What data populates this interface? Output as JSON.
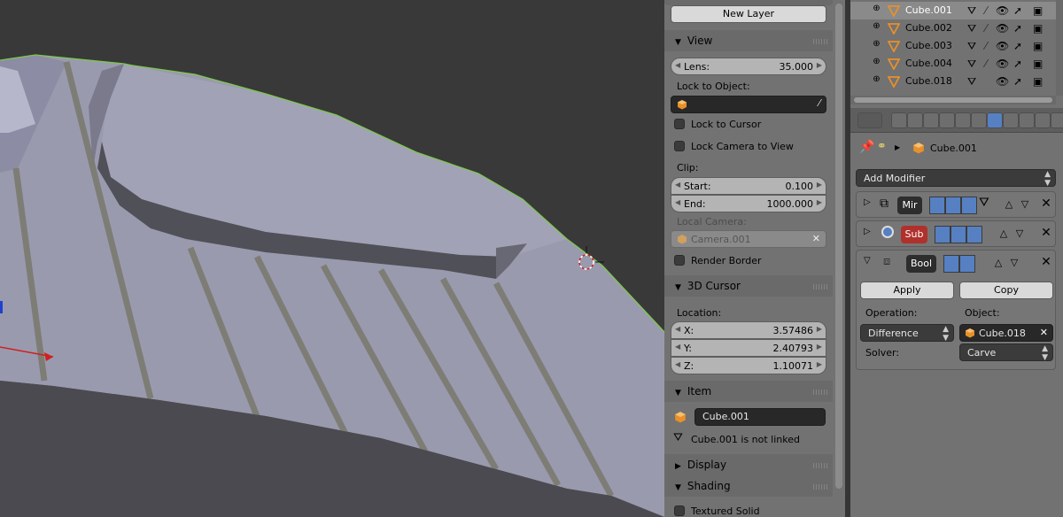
{
  "npanel": {
    "new_layer": "New Layer",
    "view": {
      "title": "View",
      "lens_label": "Lens:",
      "lens_value": "35.000",
      "lock_to_object_label": "Lock to Object:",
      "lock_to_cursor": "Lock to Cursor",
      "lock_camera_to_view": "Lock Camera to View",
      "clip_label": "Clip:",
      "clip_start_label": "Start:",
      "clip_start_value": "0.100",
      "clip_end_label": "End:",
      "clip_end_value": "1000.000",
      "local_camera_label": "Local Camera:",
      "local_camera_value": "Camera.001",
      "render_border": "Render Border"
    },
    "cursor": {
      "title": "3D Cursor",
      "location_label": "Location:",
      "x_label": "X:",
      "x_value": "3.57486",
      "y_label": "Y:",
      "y_value": "2.40793",
      "z_label": "Z:",
      "z_value": "1.10071"
    },
    "item": {
      "title": "Item",
      "name": "Cube.001",
      "linked_status": "Cube.001 is not linked"
    },
    "display": {
      "title": "Display"
    },
    "shading": {
      "title": "Shading",
      "textured_solid": "Textured Solid"
    }
  },
  "outliner": {
    "items": [
      {
        "name": "Cube.001",
        "selected": true
      },
      {
        "name": "Cube.002",
        "selected": false
      },
      {
        "name": "Cube.003",
        "selected": false
      },
      {
        "name": "Cube.004",
        "selected": false
      },
      {
        "name": "Cube.018",
        "selected": false
      }
    ]
  },
  "properties": {
    "breadcrumb_object": "Cube.001",
    "add_modifier": "Add Modifier",
    "modifiers": [
      {
        "name": "Mir"
      },
      {
        "name": "Sub"
      },
      {
        "name": "Bool"
      }
    ],
    "apply": "Apply",
    "copy": "Copy",
    "operation_label": "Operation:",
    "operation_value": "Difference",
    "object_label": "Object:",
    "object_value": "Cube.018",
    "solver_label": "Solver:",
    "solver_value": "Carve"
  },
  "colors": {
    "viewport_bg": "#393939",
    "mesh_face": "#9a9ab0",
    "selection_outline": "#7ec850",
    "accent_blue": "#5680c2",
    "object_orange": "#e8902a"
  }
}
